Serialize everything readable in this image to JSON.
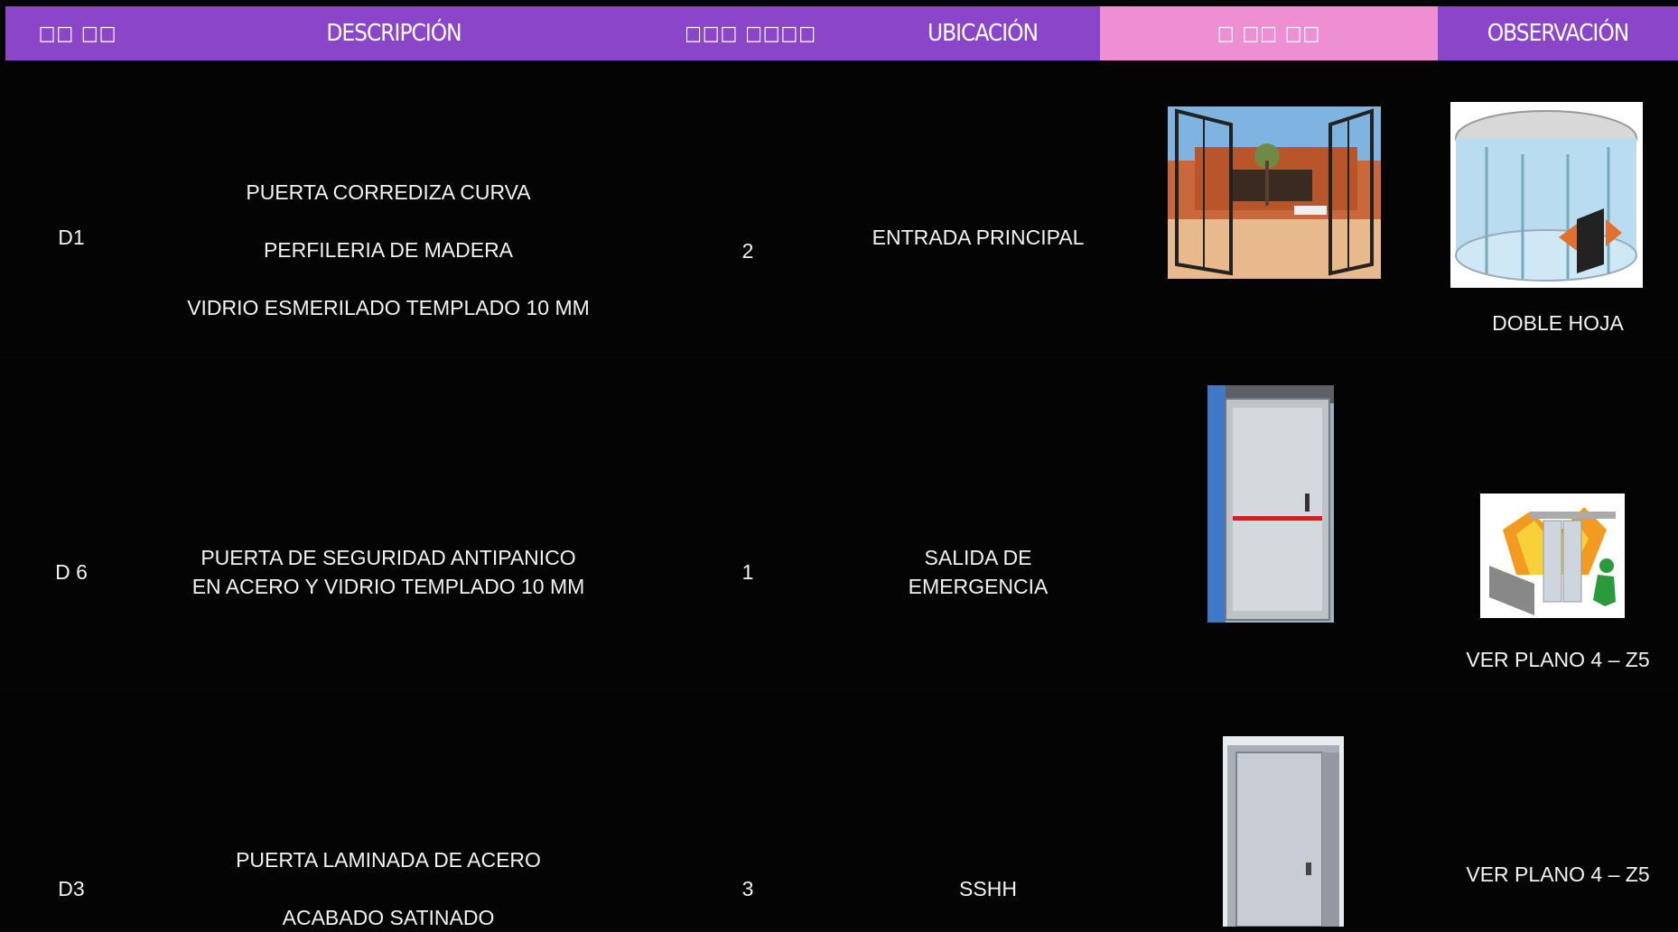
{
  "header": {
    "col_code": "□□ □□",
    "col_description": "DESCRIPCIÓN",
    "col_quantity": "□□□ □□□□",
    "col_location": "UBICACIÓN",
    "col_image": "□ □□ □□",
    "col_observation": "OBSERVACIÓN"
  },
  "colors": {
    "header_bg": "#8b45c9",
    "header_highlight": "#ee8fd4",
    "page_bg": "#060606",
    "text": "#f2f2f2"
  },
  "rows": [
    {
      "code": "D1",
      "description_lines": [
        "PUERTA CORREDIZA  CURVA",
        "PERFILERIA DE MADERA",
        "VIDRIO  ESMERILADO TEMPLADO  10 MM"
      ],
      "quantity": "2",
      "location": "ENTRADA PRINCIPAL",
      "image": "open-glass-door-courtyard-photo",
      "observation_image": "curved-sliding-door-illustration",
      "observation_text": ""
    },
    {
      "code": "D 6",
      "description_lines": [
        "PUERTA DE SEGURIDAD ANTIPANICO",
        "EN ACERO Y VIDRIO TEMPLADO 10  MM"
      ],
      "quantity": "1",
      "location_lines": [
        "SALIDA DE",
        "EMERGENCIA"
      ],
      "image": "steel-emergency-door-photo",
      "observation_top": "DOBLE  HOJA",
      "observation_image": "fire-exit-door-illustration",
      "observation_text": "VER PLANO 4 – Z5"
    },
    {
      "code": "D3",
      "description_lines": [
        "PUERTA LAMINADA  DE ACERO",
        "ACABADO SATINADO"
      ],
      "quantity": "3",
      "location": "SSHH",
      "image": "stainless-steel-door-photo",
      "observation_text": "VER PLANO 4 – Z5"
    }
  ]
}
